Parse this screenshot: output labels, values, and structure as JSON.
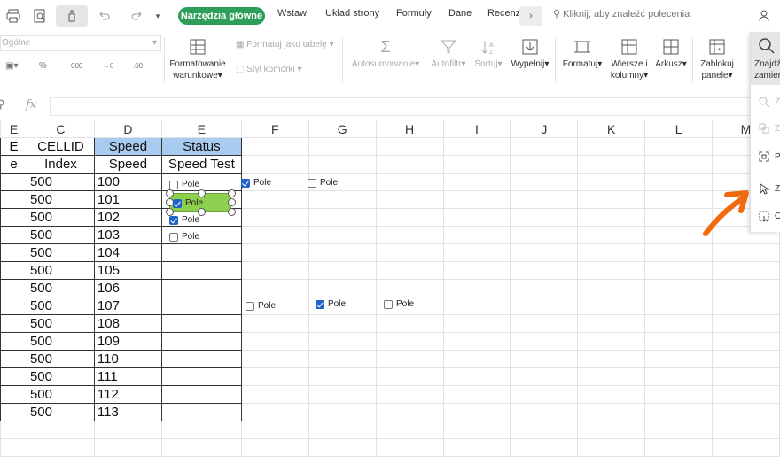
{
  "toolbar": {
    "tabs": [
      "Narzędzia główne",
      "Wstaw",
      "Układ strony",
      "Formuły",
      "Dane",
      "Recenz"
    ],
    "more": "›",
    "search_placeholder": "Kliknij, aby znaleźć polecenia"
  },
  "ribbon": {
    "number_format": "Ogólne",
    "percent": "%",
    "thousands": "000",
    "dec_inc": "←0",
    "dec_dec": ".00",
    "cond_format": [
      "Formatowanie",
      "warunkowe"
    ],
    "format_table": "Formatuj jako tabelę",
    "cell_style": "Styl komórki",
    "autosum": "Autosumowanie",
    "autofilter": "Autofiltr",
    "sort": "Sortuj",
    "fill": "Wypełnij",
    "format": "Formatuj",
    "rows_cols": [
      "Wiersze i",
      "kolumny"
    ],
    "sheet": "Arkusz",
    "freeze": [
      "Zablokuj",
      "panele"
    ],
    "find_replace": [
      "Znajdź",
      "zamień"
    ]
  },
  "formula_bar": {
    "fx": "fx"
  },
  "grid": {
    "columns": [
      "E",
      "C",
      "D",
      "E",
      "F",
      "G",
      "H",
      "I",
      "J",
      "K",
      "L",
      "M"
    ],
    "header_row1": [
      "E",
      "CELLID",
      "Speed",
      "Status"
    ],
    "header_row2": [
      "e",
      "Index",
      "Speed",
      "Speed Test"
    ],
    "col_c": [
      "500",
      "500",
      "500",
      "500",
      "500",
      "500",
      "500",
      "500",
      "500",
      "500",
      "500",
      "500",
      "500",
      "500"
    ],
    "col_d": [
      "100",
      "101",
      "102",
      "103",
      "104",
      "105",
      "106",
      "107",
      "108",
      "109",
      "110",
      "111",
      "112",
      "113"
    ]
  },
  "checkboxes": [
    {
      "label": "Pole",
      "checked": false
    },
    {
      "label": "Pole",
      "checked": true
    },
    {
      "label": "Pole",
      "checked": true
    },
    {
      "label": "Pole",
      "checked": false
    },
    {
      "label": "Pole",
      "checked": true
    },
    {
      "label": "Pole",
      "checked": false
    },
    {
      "label": "Pole",
      "checked": false
    },
    {
      "label": "Pole",
      "checked": true
    },
    {
      "label": "Pole",
      "checked": false
    }
  ],
  "find_pane": {
    "items": [
      "Z",
      "Z",
      "P",
      "Z",
      "O"
    ]
  },
  "colors": {
    "accent_tab": "#2e9e5b",
    "header_highlight": "#a9cbef",
    "selected_checkbox": "#8fcf4f",
    "arrow": "#f26a10"
  }
}
